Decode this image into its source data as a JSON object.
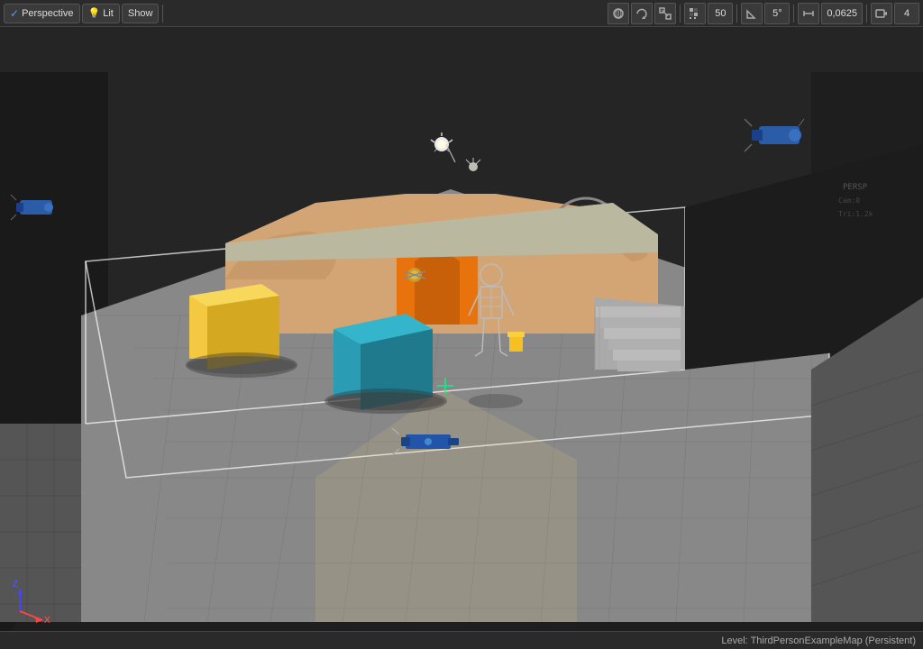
{
  "toolbar": {
    "perspective_label": "Perspective",
    "lit_label": "Lit",
    "show_label": "Show",
    "fov_value": "50",
    "angle_value": "5°",
    "scale_value": "0,0625",
    "camera_count": "4",
    "icons": {
      "perspective_dot": "#4a9eff",
      "lit_dot": "#ffaa44"
    }
  },
  "statusbar": {
    "level_text": "Level:  ThirdPersonExampleMap (Persistent)"
  },
  "scene": {
    "background_top": "#2a2a2a",
    "background_bottom": "#1e1e1e"
  }
}
